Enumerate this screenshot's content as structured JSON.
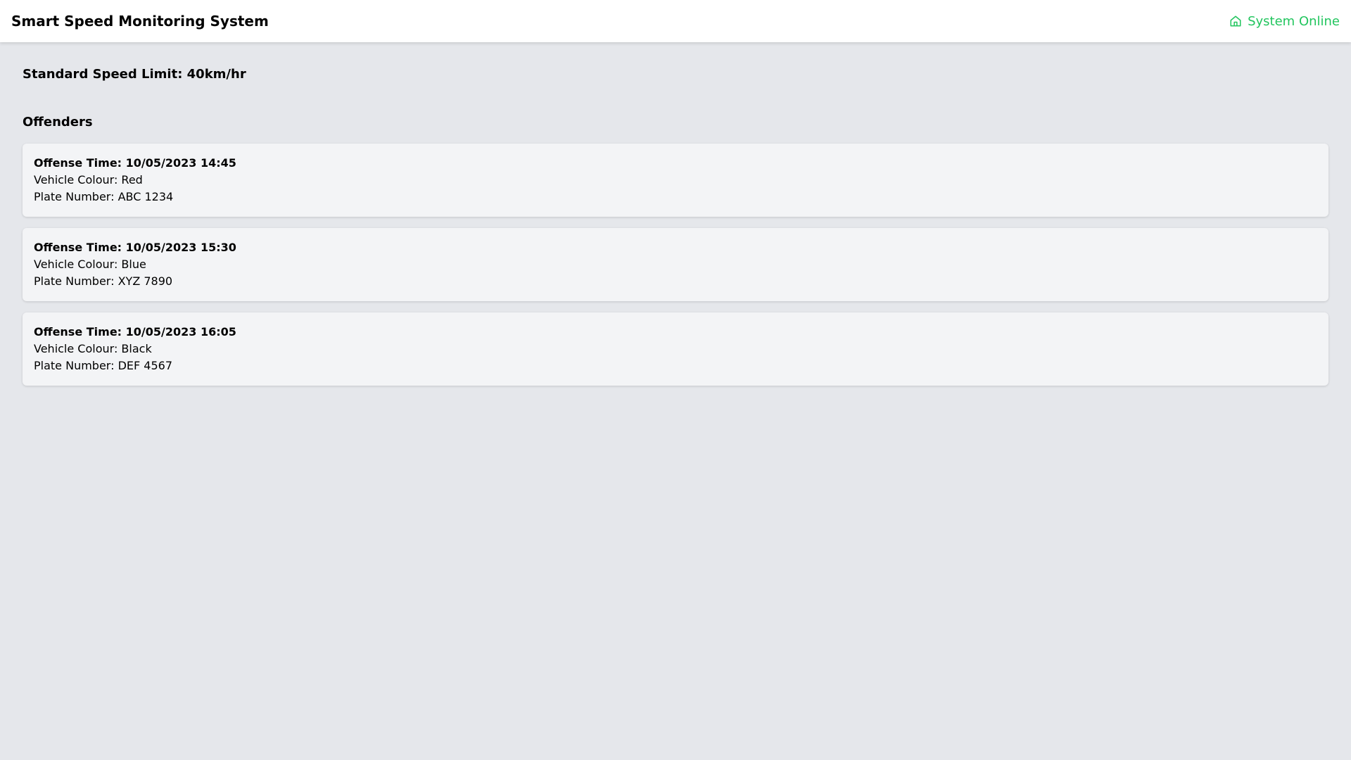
{
  "header": {
    "title": "Smart Speed Monitoring System",
    "status_text": "System Online",
    "status_icon": "home-icon",
    "status_color": "#22c55e"
  },
  "speed_limit": {
    "label": "Standard Speed Limit",
    "value": "40km/hr"
  },
  "offenders": {
    "title": "Offenders",
    "labels": {
      "time": "Offense Time",
      "colour": "Vehicle Colour",
      "plate": "Plate Number"
    },
    "items": [
      {
        "time": "10/05/2023 14:45",
        "colour": "Red",
        "plate": "ABC 1234"
      },
      {
        "time": "10/05/2023 15:30",
        "colour": "Blue",
        "plate": "XYZ 7890"
      },
      {
        "time": "10/05/2023 16:05",
        "colour": "Black",
        "plate": "DEF 4567"
      }
    ]
  }
}
